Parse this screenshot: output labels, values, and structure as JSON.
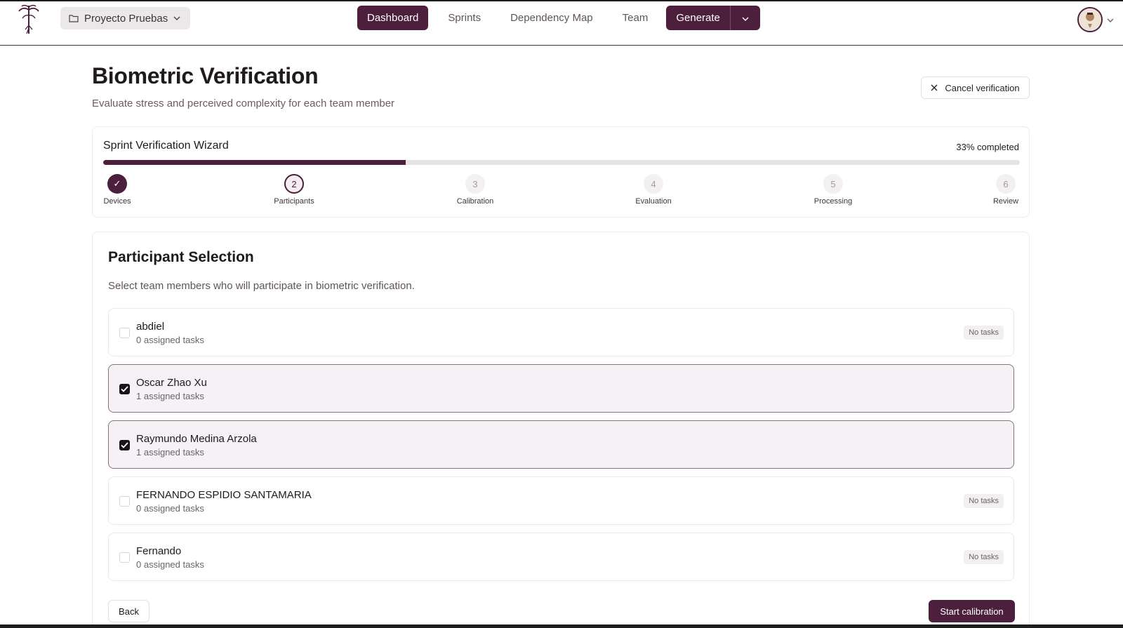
{
  "header": {
    "project": "Proyecto Pruebas",
    "nav": [
      "Dashboard",
      "Sprints",
      "Dependency Map",
      "Team"
    ],
    "active_nav": "Dashboard",
    "generate_label": "Generate"
  },
  "page": {
    "title": "Biometric Verification",
    "subtitle": "Evaluate stress and perceived complexity for each team member",
    "cancel_label": "Cancel verification"
  },
  "wizard": {
    "title": "Sprint Verification Wizard",
    "progress_text": "33% completed",
    "progress_fraction": 0.33,
    "steps": [
      {
        "num": "✓",
        "label": "Devices",
        "state": "done"
      },
      {
        "num": "2",
        "label": "Participants",
        "state": "current"
      },
      {
        "num": "3",
        "label": "Calibration",
        "state": "pending"
      },
      {
        "num": "4",
        "label": "Evaluation",
        "state": "pending"
      },
      {
        "num": "5",
        "label": "Processing",
        "state": "pending"
      },
      {
        "num": "6",
        "label": "Review",
        "state": "pending"
      }
    ]
  },
  "participants": {
    "title": "Participant Selection",
    "description": "Select team members who will participate in biometric verification.",
    "rows": [
      {
        "name": "abdiel",
        "tasks": "0 assigned tasks",
        "selected": false,
        "badge": "No tasks"
      },
      {
        "name": "Oscar Zhao Xu",
        "tasks": "1 assigned tasks",
        "selected": true,
        "badge": ""
      },
      {
        "name": "Raymundo Medina Arzola",
        "tasks": "1 assigned tasks",
        "selected": true,
        "badge": ""
      },
      {
        "name": "FERNANDO ESPIDIO SANTAMARIA",
        "tasks": "0 assigned tasks",
        "selected": false,
        "badge": "No tasks"
      },
      {
        "name": "Fernando",
        "tasks": "0 assigned tasks",
        "selected": false,
        "badge": "No tasks"
      }
    ],
    "back_label": "Back",
    "start_label": "Start calibration"
  },
  "colors": {
    "accent": "#4c1f3c",
    "selected_row_bg": "#f5f1f4"
  }
}
